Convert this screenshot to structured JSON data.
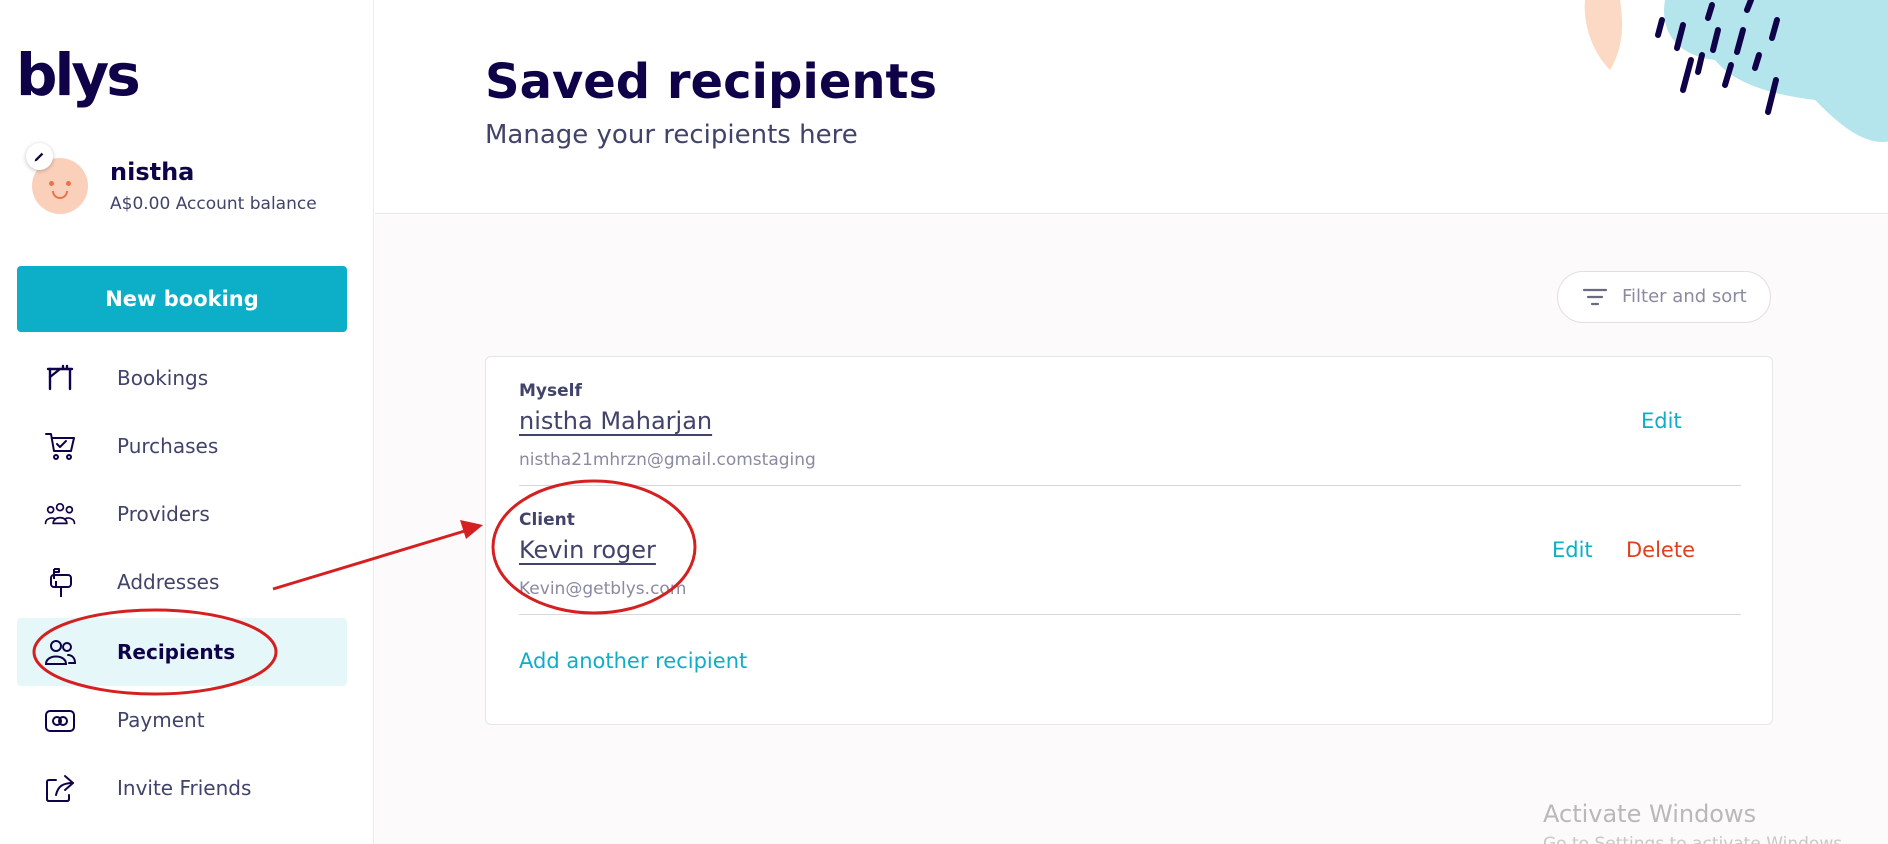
{
  "brand": {
    "logo": "blys",
    "accent": "#0daec8",
    "navy": "#100249"
  },
  "user": {
    "name": "nistha",
    "balance": "A$0.00 Account balance"
  },
  "sidebar": {
    "new_booking": "New booking",
    "items": [
      {
        "label": "Bookings",
        "icon": "bookings-icon"
      },
      {
        "label": "Purchases",
        "icon": "cart-icon"
      },
      {
        "label": "Providers",
        "icon": "providers-icon"
      },
      {
        "label": "Addresses",
        "icon": "mailbox-icon"
      },
      {
        "label": "Recipients",
        "icon": "recipients-icon",
        "active": true
      },
      {
        "label": "Payment",
        "icon": "payment-icon"
      },
      {
        "label": "Invite Friends",
        "icon": "share-icon"
      }
    ]
  },
  "header": {
    "title": "Saved recipients",
    "subtitle": "Manage your recipients here"
  },
  "toolbar": {
    "filter_label": "Filter and sort"
  },
  "recipients": [
    {
      "type": "Myself",
      "name": "nistha Maharjan",
      "email": "nistha21mhrzn@gmail.comstaging",
      "edit": "Edit"
    },
    {
      "type": "Client",
      "name": "Kevin roger",
      "email": "Kevin@getblys.com",
      "edit": "Edit",
      "delete": "Delete"
    }
  ],
  "add_recipient": "Add another recipient",
  "watermark": {
    "title": "Activate Windows",
    "subtitle": "Go to Settings to activate Windows."
  },
  "annotation_color": "#d42020"
}
